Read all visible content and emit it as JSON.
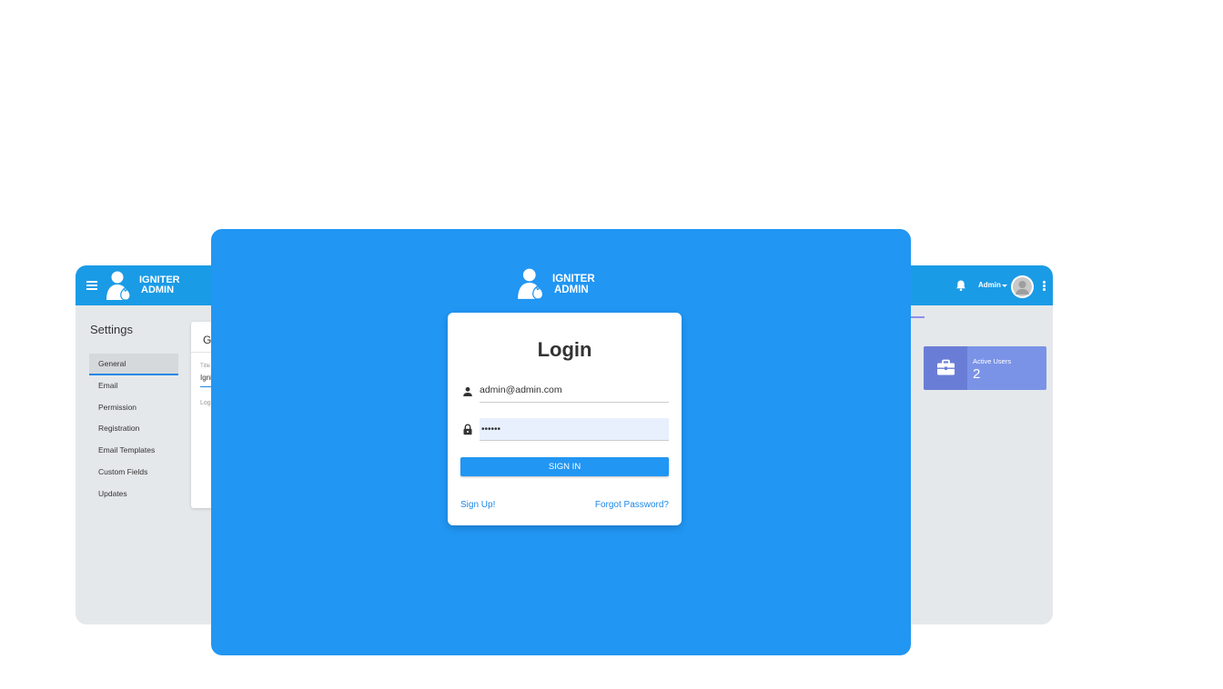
{
  "background_window": {
    "brand_line1": "IGNITER",
    "brand_line2": "ADMIN",
    "settings_title": "Settings",
    "settings_nav": [
      "General",
      "Email",
      "Permission",
      "Registration",
      "Email Templates",
      "Custom Fields",
      "Updates"
    ],
    "settings_card": {
      "heading": "G",
      "field_label": "Title",
      "field_value": "Igni",
      "second_label": "Log"
    },
    "header": {
      "user_label": "Admin"
    },
    "stat_card": {
      "label": "Active Users",
      "value": "2"
    }
  },
  "login_window": {
    "brand_line1": "IGNITER",
    "brand_line2": "ADMIN",
    "login_title": "Login",
    "email_value": "admin@admin.com",
    "password_value": "••••••",
    "signin_label": "SIGN IN",
    "signup_label": "Sign Up!",
    "forgot_label": "Forgot Password?"
  },
  "colors": {
    "primary_blue": "#2196f3",
    "topbar_blue": "#1a9be6",
    "link_blue": "#1e88e5",
    "stat_card": "#7b93e7",
    "background_gray": "#e5e8eb"
  },
  "icons": [
    "menu-icon",
    "logo-icon",
    "bell-icon",
    "avatar",
    "more-vert-icon",
    "briefcase-icon",
    "user-icon",
    "lock-icon"
  ]
}
